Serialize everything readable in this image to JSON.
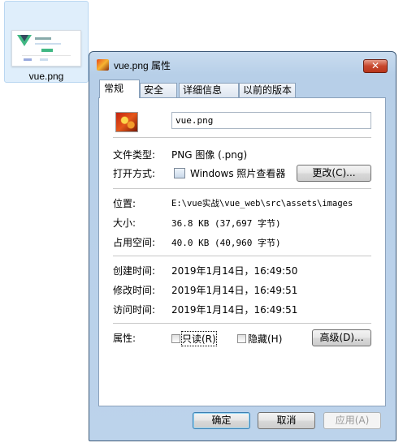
{
  "desktop_file": {
    "label": "vue.png"
  },
  "window": {
    "title": "vue.png 属性",
    "close_label": "✕"
  },
  "tabs": [
    {
      "label": "常规"
    },
    {
      "label": "安全"
    },
    {
      "label": "详细信息"
    },
    {
      "label": "以前的版本"
    }
  ],
  "general": {
    "file_name": "vue.png",
    "file_type_label": "文件类型:",
    "file_type_value": "PNG 图像 (.png)",
    "opens_with_label": "打开方式:",
    "opens_with_value": "Windows 照片查看器",
    "change_button": "更改(C)...",
    "location_label": "位置:",
    "location_value": "E:\\vue实战\\vue_web\\src\\assets\\images",
    "size_label": "大小:",
    "size_value": "36.8 KB (37,697 字节)",
    "size_on_disk_label": "占用空间:",
    "size_on_disk_value": "40.0 KB (40,960 字节)",
    "created_label": "创建时间:",
    "created_value": "2019年1月14日，16:49:50",
    "modified_label": "修改时间:",
    "modified_value": "2019年1月14日，16:49:51",
    "accessed_label": "访问时间:",
    "accessed_value": "2019年1月14日，16:49:51",
    "attributes_label": "属性:",
    "readonly_label": "只读(R)",
    "hidden_label": "隐藏(H)",
    "advanced_button": "高级(D)..."
  },
  "footer": {
    "ok": "确定",
    "cancel": "取消",
    "apply": "应用(A)"
  },
  "icons": {
    "title_icon": "image-file-icon",
    "file_icon": "image-file-icon",
    "app_icon": "photo-viewer-icon"
  }
}
